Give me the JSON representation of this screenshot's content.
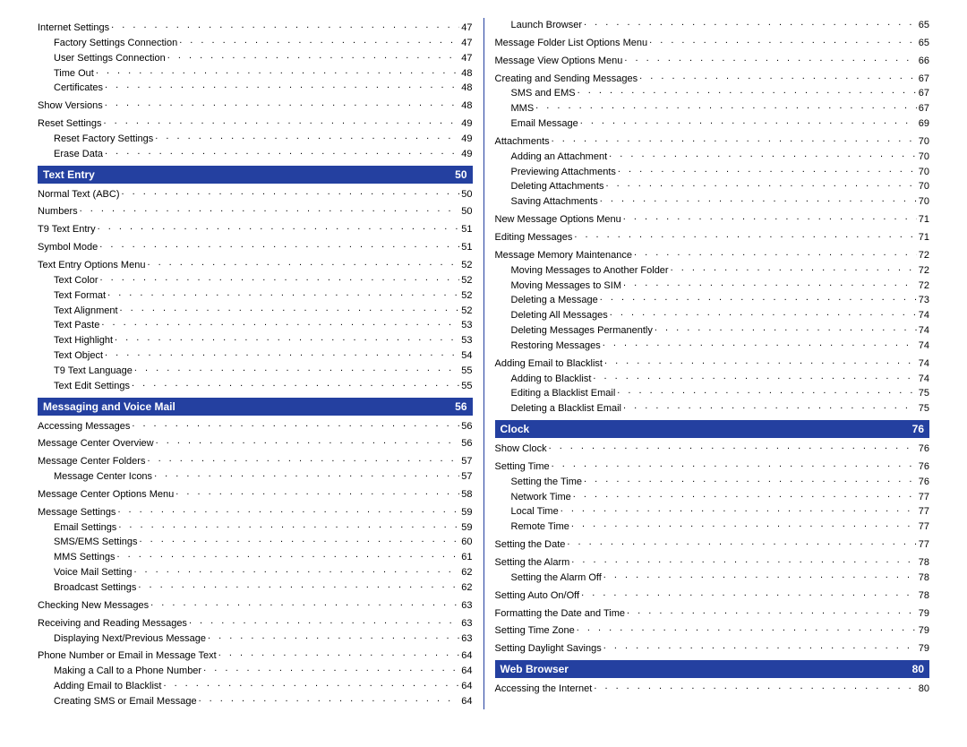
{
  "columns": [
    {
      "blocks": [
        {
          "type": "entries",
          "entries": [
            {
              "level": 0,
              "label": "Internet Settings",
              "page": "47"
            },
            {
              "level": 1,
              "label": "Factory Settings Connection",
              "page": "47"
            },
            {
              "level": 1,
              "label": "User Settings Connection",
              "page": "47"
            },
            {
              "level": 1,
              "label": "Time Out",
              "page": "48"
            },
            {
              "level": 1,
              "label": "Certificates",
              "page": "48"
            },
            {
              "level": 0,
              "label": "Show Versions",
              "page": "48"
            },
            {
              "level": 0,
              "label": "Reset Settings",
              "page": "49"
            },
            {
              "level": 1,
              "label": "Reset Factory Settings",
              "page": "49"
            },
            {
              "level": 1,
              "label": "Erase Data",
              "page": "49"
            }
          ]
        },
        {
          "type": "header",
          "title": "Text Entry",
          "page": "50"
        },
        {
          "type": "entries",
          "entries": [
            {
              "level": 0,
              "label": "Normal Text (ABC)",
              "page": "50"
            },
            {
              "level": 0,
              "label": "Numbers",
              "page": "50"
            },
            {
              "level": 0,
              "label": "T9 Text Entry",
              "page": "51"
            },
            {
              "level": 0,
              "label": "Symbol Mode",
              "page": "51"
            },
            {
              "level": 0,
              "label": "Text Entry Options Menu",
              "page": "52"
            },
            {
              "level": 1,
              "label": "Text Color",
              "page": "52"
            },
            {
              "level": 1,
              "label": "Text Format",
              "page": "52"
            },
            {
              "level": 1,
              "label": "Text Alignment",
              "page": "52"
            },
            {
              "level": 1,
              "label": "Text Paste",
              "page": "53"
            },
            {
              "level": 1,
              "label": "Text Highlight",
              "page": "53"
            },
            {
              "level": 1,
              "label": "Text Object",
              "page": "54"
            },
            {
              "level": 1,
              "label": "T9 Text Language",
              "page": "55"
            },
            {
              "level": 1,
              "label": "Text Edit Settings",
              "page": "55"
            }
          ]
        },
        {
          "type": "header",
          "title": "Messaging and Voice Mail",
          "page": "56"
        },
        {
          "type": "entries",
          "entries": [
            {
              "level": 0,
              "label": "Accessing Messages",
              "page": "56"
            },
            {
              "level": 0,
              "label": "Message Center Overview",
              "page": "56"
            },
            {
              "level": 0,
              "label": "Message Center Folders",
              "page": "57"
            },
            {
              "level": 1,
              "label": "Message Center Icons",
              "page": "57"
            },
            {
              "level": 0,
              "label": "Message Center Options Menu",
              "page": "58"
            },
            {
              "level": 0,
              "label": "Message Settings",
              "page": "59"
            },
            {
              "level": 1,
              "label": "Email Settings",
              "page": "59"
            },
            {
              "level": 1,
              "label": "SMS/EMS Settings",
              "page": "60"
            },
            {
              "level": 1,
              "label": "MMS Settings",
              "page": "61"
            },
            {
              "level": 1,
              "label": "Voice Mail Setting",
              "page": "62"
            },
            {
              "level": 1,
              "label": "Broadcast Settings",
              "page": "62"
            },
            {
              "level": 0,
              "label": "Checking New Messages",
              "page": "63"
            },
            {
              "level": 0,
              "label": "Receiving and Reading Messages",
              "page": "63"
            },
            {
              "level": 1,
              "label": "Displaying Next/Previous Message",
              "page": "63"
            },
            {
              "level": 0,
              "label": "Phone Number or Email in Message Text",
              "page": "64"
            },
            {
              "level": 1,
              "label": "Making a Call to a Phone Number",
              "page": "64"
            },
            {
              "level": 1,
              "label": "Adding Email to Blacklist",
              "page": "64"
            },
            {
              "level": 1,
              "label": "Creating SMS or Email Message",
              "page": "64"
            }
          ]
        }
      ]
    },
    {
      "blocks": [
        {
          "type": "entries",
          "entries": [
            {
              "level": 1,
              "label": "Launch Browser",
              "page": "65"
            },
            {
              "level": 0,
              "label": "Message Folder List Options Menu",
              "page": "65"
            },
            {
              "level": 0,
              "label": "Message View Options Menu",
              "page": "66"
            },
            {
              "level": 0,
              "label": "Creating and Sending Messages",
              "page": "67"
            },
            {
              "level": 1,
              "label": "SMS and EMS",
              "page": "67"
            },
            {
              "level": 1,
              "label": "MMS",
              "page": "67"
            },
            {
              "level": 1,
              "label": "Email Message",
              "page": "69"
            },
            {
              "level": 0,
              "label": "Attachments",
              "page": "70"
            },
            {
              "level": 1,
              "label": "Adding an Attachment",
              "page": "70"
            },
            {
              "level": 1,
              "label": "Previewing Attachments",
              "page": "70"
            },
            {
              "level": 1,
              "label": "Deleting Attachments",
              "page": "70"
            },
            {
              "level": 1,
              "label": "Saving Attachments",
              "page": "70"
            },
            {
              "level": 0,
              "label": "New Message Options Menu",
              "page": "71"
            },
            {
              "level": 0,
              "label": "Editing Messages",
              "page": "71"
            },
            {
              "level": 0,
              "label": "Message Memory Maintenance",
              "page": "72"
            },
            {
              "level": 1,
              "label": "Moving Messages to Another Folder",
              "page": "72"
            },
            {
              "level": 1,
              "label": "Moving Messages to SIM",
              "page": "72"
            },
            {
              "level": 1,
              "label": "Deleting a Message",
              "page": "73"
            },
            {
              "level": 1,
              "label": "Deleting All Messages",
              "page": "74"
            },
            {
              "level": 1,
              "label": "Deleting Messages Permanently",
              "page": "74"
            },
            {
              "level": 1,
              "label": "Restoring Messages",
              "page": "74"
            },
            {
              "level": 0,
              "label": "Adding Email to Blacklist",
              "page": "74"
            },
            {
              "level": 1,
              "label": "Adding to Blacklist",
              "page": "74"
            },
            {
              "level": 1,
              "label": "Editing a Blacklist Email",
              "page": "75"
            },
            {
              "level": 1,
              "label": "Deleting a Blacklist Email",
              "page": "75"
            }
          ]
        },
        {
          "type": "header",
          "title": "Clock",
          "page": "76"
        },
        {
          "type": "entries",
          "entries": [
            {
              "level": 0,
              "label": "Show Clock",
              "page": "76"
            },
            {
              "level": 0,
              "label": "Setting Time",
              "page": "76"
            },
            {
              "level": 1,
              "label": "Setting the Time",
              "page": "76"
            },
            {
              "level": 1,
              "label": "Network Time",
              "page": "77"
            },
            {
              "level": 1,
              "label": "Local Time",
              "page": "77"
            },
            {
              "level": 1,
              "label": "Remote Time",
              "page": "77"
            },
            {
              "level": 0,
              "label": "Setting the Date",
              "page": "77"
            },
            {
              "level": 0,
              "label": "Setting the Alarm",
              "page": "78"
            },
            {
              "level": 1,
              "label": "Setting the Alarm Off",
              "page": "78"
            },
            {
              "level": 0,
              "label": "Setting Auto On/Off",
              "page": "78"
            },
            {
              "level": 0,
              "label": "Formatting the Date and Time",
              "page": "79"
            },
            {
              "level": 0,
              "label": "Setting Time Zone",
              "page": "79"
            },
            {
              "level": 0,
              "label": "Setting Daylight Savings",
              "page": "79"
            }
          ]
        },
        {
          "type": "header",
          "title": "Web Browser",
          "page": "80"
        },
        {
          "type": "entries",
          "entries": [
            {
              "level": 0,
              "label": "Accessing the Internet",
              "page": "80"
            }
          ]
        }
      ]
    }
  ]
}
